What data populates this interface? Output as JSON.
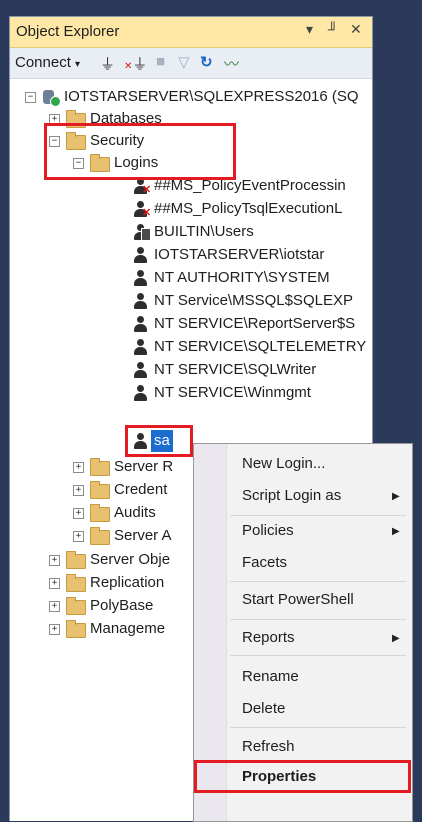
{
  "panel": {
    "title": "Object Explorer",
    "pin_glyph": "▾ ╜ ✕"
  },
  "toolbar": {
    "connect_label": "Connect",
    "connect_arrow": "▾",
    "icons": [
      "plug-icon",
      "disconnect-icon",
      "stop-icon",
      "filter-icon",
      "refresh-icon",
      "activity-monitor-icon"
    ]
  },
  "tree": {
    "server": "IOTSTARSERVER\\SQLEXPRESS2016 (SQ",
    "databases": "Databases",
    "security": "Security",
    "logins": "Logins",
    "login_items": [
      "##MS_PolicyEventProcessin",
      "##MS_PolicyTsqlExecutionL",
      "BUILTIN\\Users",
      "IOTSTARSERVER\\iotstar",
      "NT AUTHORITY\\SYSTEM",
      "NT Service\\MSSQL$SQLEXP",
      "NT SERVICE\\ReportServer$S",
      "NT SERVICE\\SQLTELEMETRY",
      "NT SERVICE\\SQLWriter",
      "NT SERVICE\\Winmgmt"
    ],
    "selected_login": "sa",
    "security_children": [
      "Server R",
      "Credent",
      "Audits",
      "Server A"
    ],
    "server_children": [
      "Server Obje",
      "Replication",
      "PolyBase",
      "Manageme"
    ]
  },
  "context_menu": {
    "items": [
      "New Login...",
      "Script Login as",
      "Policies",
      "Facets",
      "Start PowerShell",
      "Reports",
      "Rename",
      "Delete",
      "Refresh",
      "Properties"
    ]
  },
  "colors": {
    "accent": "#1c6dd0",
    "highlight_box": "#e31b23",
    "title_bar": "#ffe8a6"
  }
}
